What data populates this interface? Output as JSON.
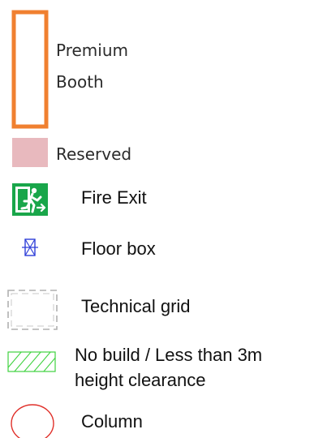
{
  "legend": {
    "items": [
      {
        "id": "premium-booth",
        "lines": [
          "Premium",
          "Booth"
        ],
        "color": "#F08030"
      },
      {
        "id": "reserved",
        "label": "Reserved",
        "color": "#E8B9BE"
      },
      {
        "id": "fire-exit",
        "label": "Fire Exit",
        "color": "#19A64A"
      },
      {
        "id": "floor-box",
        "label": "Floor box",
        "color": "#2F3FD8"
      },
      {
        "id": "technical-grid",
        "label": "Technical grid",
        "color": "#9E9E9E"
      },
      {
        "id": "no-build",
        "lines": [
          "No build / Less than 3m",
          "height clearance"
        ],
        "color": "#3FD23F"
      },
      {
        "id": "column",
        "label": "Column",
        "color": "#E0302A"
      }
    ]
  }
}
